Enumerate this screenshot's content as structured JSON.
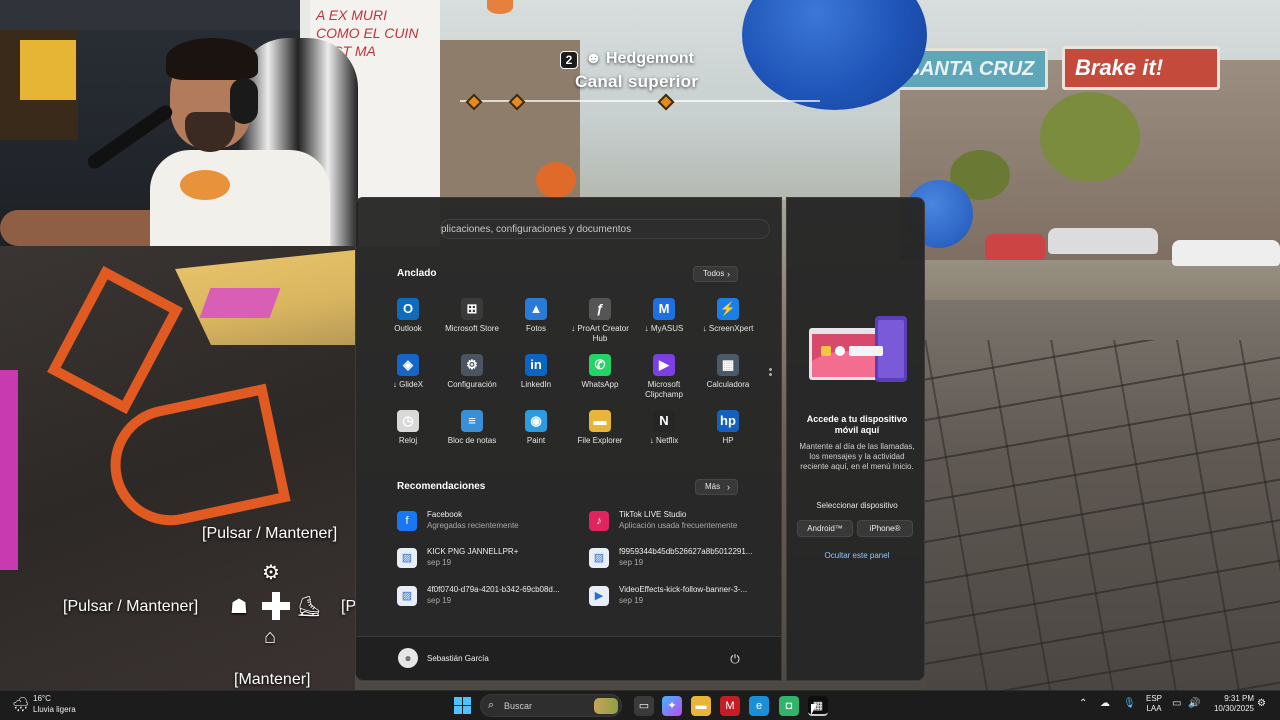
{
  "game": {
    "hud_badge": "2",
    "hud_name": "Hedgemont",
    "hud_subtitle": "Canal superior",
    "sign_left": "SANTA CRUZ",
    "sign_right": "Brake it!",
    "control_top": "[Pulsar / Mantener]",
    "control_left": "[Pulsar / Mantener]",
    "control_right": "[P",
    "control_bottom": "[Mantener]"
  },
  "webcam": {
    "whiteboard_text": "A EX MURI\nCOMO EL CUIN\nJUST MA"
  },
  "start_menu": {
    "search_placeholder": "plicaciones, configuraciones y documentos",
    "pinned_title": "Anclado",
    "all_button": "Todos",
    "pinned_apps": [
      {
        "label": "Outlook",
        "icon": "outlook-icon",
        "color": "#0f6cbd",
        "glyph": "O"
      },
      {
        "label": "Microsoft Store",
        "icon": "store-icon",
        "color": "#3a3a3a",
        "glyph": "⊞"
      },
      {
        "label": "Fotos",
        "icon": "photos-icon",
        "color": "#2a7bd8",
        "glyph": "▲"
      },
      {
        "label": "↓ ProArt Creator Hub",
        "icon": "proart-icon",
        "color": "#555555",
        "glyph": "ƒ"
      },
      {
        "label": "↓ MyASUS",
        "icon": "myasus-icon",
        "color": "#1f6fe0",
        "glyph": "M"
      },
      {
        "label": "↓ ScreenXpert",
        "icon": "screenxpert-icon",
        "color": "#1a7fe6",
        "glyph": "⚡"
      },
      {
        "label": "↓ GlideX",
        "icon": "glidex-icon",
        "color": "#1666c8",
        "glyph": "◈"
      },
      {
        "label": "Configuración",
        "icon": "settings-icon",
        "color": "#4a5560",
        "glyph": "⚙"
      },
      {
        "label": "LinkedIn",
        "icon": "linkedin-icon",
        "color": "#0a66c2",
        "glyph": "in"
      },
      {
        "label": "WhatsApp",
        "icon": "whatsapp-icon",
        "color": "#25d366",
        "glyph": "✆"
      },
      {
        "label": "Microsoft Clipchamp",
        "icon": "clipchamp-icon",
        "color": "#7b3fe4",
        "glyph": "▶"
      },
      {
        "label": "Calculadora",
        "icon": "calculator-icon",
        "color": "#4a5a66",
        "glyph": "▦"
      },
      {
        "label": "Reloj",
        "icon": "clock-icon",
        "color": "#d9d9d9",
        "glyph": "◷"
      },
      {
        "label": "Bloc de notas",
        "icon": "notepad-icon",
        "color": "#3b8fd6",
        "glyph": "≡"
      },
      {
        "label": "Paint",
        "icon": "paint-icon",
        "color": "#2c9be0",
        "glyph": "◉"
      },
      {
        "label": "File Explorer",
        "icon": "folder-icon",
        "color": "#e8b53a",
        "glyph": "▬"
      },
      {
        "label": "↓ Netflix",
        "icon": "netflix-icon",
        "color": "#262626",
        "glyph": "N"
      },
      {
        "label": "HP",
        "icon": "hp-icon",
        "color": "#1560bd",
        "glyph": "hp"
      }
    ],
    "recommended_title": "Recomendaciones",
    "more_button": "Más",
    "recommended": [
      {
        "title": "Facebook",
        "sub": "Agregadas recientemente",
        "icon": "facebook-icon",
        "color": "#1877f2",
        "glyph": "f"
      },
      {
        "title": "TikTok LIVE Studio",
        "sub": "Aplicación usada frecuentemente",
        "icon": "tiktok-icon",
        "color": "#e0245e",
        "glyph": "♪"
      },
      {
        "title": "KICK PNG JANNELLPR+",
        "sub": "sep 19",
        "icon": "image-file-icon",
        "color": "#e8eef7",
        "glyph": "▨"
      },
      {
        "title": "f9959344b45db526627a8b5012291...",
        "sub": "sep 19",
        "icon": "image-file-icon",
        "color": "#e8eef7",
        "glyph": "▨"
      },
      {
        "title": "4f0f0740-d79a-4201-b342-69cb08d...",
        "sub": "sep 19",
        "icon": "image-file-icon",
        "color": "#e8eef7",
        "glyph": "▨"
      },
      {
        "title": "VideoEffects-kick-follow-banner-3-...",
        "sub": "sep 19",
        "icon": "video-file-icon",
        "color": "#e8eef7",
        "glyph": "▶"
      }
    ],
    "user_name": "Sebastián García"
  },
  "phone_panel": {
    "title": "Accede a tu dispositivo móvil aquí",
    "description": "Mantente al día de las llamadas, los mensajes y la actividad reciente aquí, en el menú Inicio.",
    "select_label": "Seleccionar dispositivo",
    "android_button": "Android™",
    "iphone_button": "iPhone®",
    "hide_link": "Ocultar este panel"
  },
  "taskbar": {
    "temperature": "16°C",
    "weather": "Lluvia ligera",
    "search_label": "Buscar",
    "language_line1": "ESP",
    "language_line2": "LAA",
    "time": "9:31 PM",
    "date": "10/30/2025"
  }
}
